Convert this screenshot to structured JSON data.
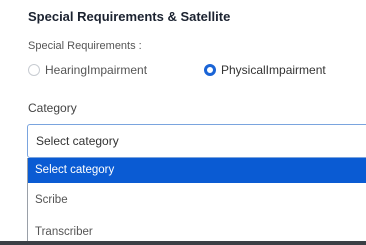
{
  "section": {
    "title": "Special Requirements & Satellite"
  },
  "special_requirements": {
    "label": "Special Requirements :",
    "options": [
      {
        "label": "HearingImpairment",
        "checked": false
      },
      {
        "label": "PhysicalImpairment",
        "checked": true
      }
    ]
  },
  "category": {
    "label": "Category",
    "selected": "Select category",
    "options": [
      {
        "label": "Select category",
        "highlighted": true
      },
      {
        "label": "Scribe",
        "highlighted": false
      },
      {
        "label": "Transcriber",
        "highlighted": false
      }
    ]
  },
  "colors": {
    "accent": "#1a64d6",
    "highlight": "#0a5bd3"
  }
}
